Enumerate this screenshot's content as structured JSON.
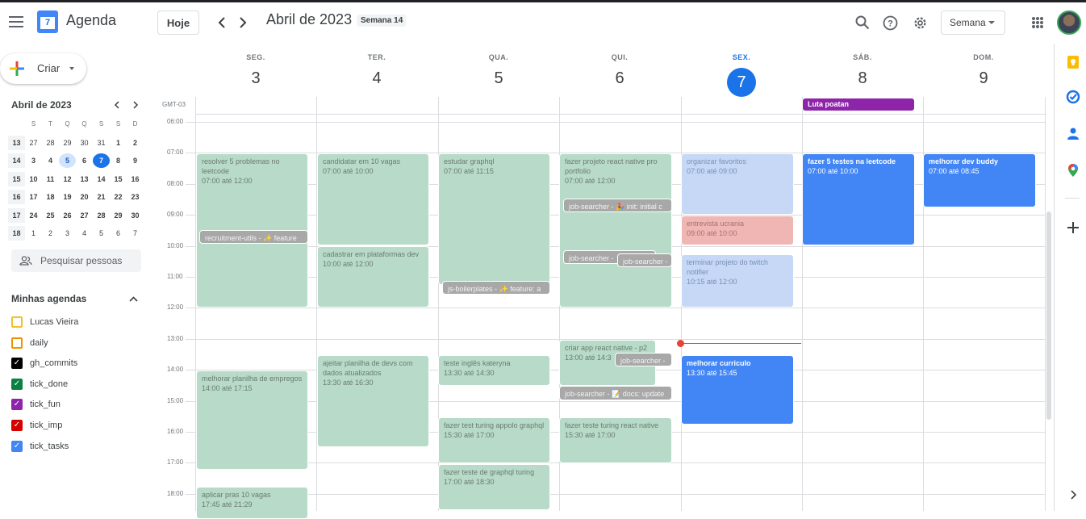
{
  "header": {
    "app_title": "Agenda",
    "logo_day": "7",
    "today_button": "Hoje",
    "month_title": "Abril de 2023",
    "week_badge": "Semana 14",
    "view_selector": "Semana"
  },
  "sidebar": {
    "create_button": "Criar",
    "mini_calendar": {
      "title": "Abril de 2023",
      "weekday_headers": [
        "S",
        "T",
        "Q",
        "Q",
        "S",
        "S",
        "D"
      ],
      "weeks": [
        {
          "week": "13",
          "days": [
            "27",
            "28",
            "29",
            "30",
            "31",
            "1",
            "2"
          ]
        },
        {
          "week": "14",
          "days": [
            "3",
            "4",
            "5",
            "6",
            "7",
            "8",
            "9"
          ]
        },
        {
          "week": "15",
          "days": [
            "10",
            "11",
            "12",
            "13",
            "14",
            "15",
            "16"
          ]
        },
        {
          "week": "16",
          "days": [
            "17",
            "18",
            "19",
            "20",
            "21",
            "22",
            "23"
          ]
        },
        {
          "week": "17",
          "days": [
            "24",
            "25",
            "26",
            "27",
            "28",
            "29",
            "30"
          ]
        },
        {
          "week": "18",
          "days": [
            "1",
            "2",
            "3",
            "4",
            "5",
            "6",
            "7"
          ]
        }
      ],
      "today": "7",
      "selected": "5"
    },
    "search_people_placeholder": "Pesquisar pessoas",
    "my_calendars_title": "Minhas agendas",
    "calendars": [
      {
        "label": "Lucas Vieira",
        "color": "#f6bf26",
        "checked": false
      },
      {
        "label": "daily",
        "color": "#f09300",
        "checked": false
      },
      {
        "label": "gh_commits",
        "color": "#000000",
        "checked": true
      },
      {
        "label": "tick_done",
        "color": "#0b8043",
        "checked": true
      },
      {
        "label": "tick_fun",
        "color": "#8e24aa",
        "checked": true
      },
      {
        "label": "tick_imp",
        "color": "#d50000",
        "checked": true
      },
      {
        "label": "tick_tasks",
        "color": "#4285f4",
        "checked": true
      }
    ]
  },
  "grid": {
    "timezone": "GMT-03",
    "days": [
      {
        "name": "SEG.",
        "num": "3"
      },
      {
        "name": "TER.",
        "num": "4"
      },
      {
        "name": "QUA.",
        "num": "5"
      },
      {
        "name": "QUI.",
        "num": "6"
      },
      {
        "name": "SEX.",
        "num": "7",
        "today": true
      },
      {
        "name": "SÁB.",
        "num": "8"
      },
      {
        "name": "DOM.",
        "num": "9"
      }
    ],
    "hours": [
      "06:00",
      "07:00",
      "08:00",
      "09:00",
      "10:00",
      "11:00",
      "12:00",
      "13:00",
      "14:00",
      "15:00",
      "16:00",
      "17:00",
      "18:00"
    ],
    "allday_event": "Luta poatan",
    "events": [
      {
        "title": "resolver 5 problemas no leetcode",
        "time": "07:00 até 12:00"
      },
      {
        "title": "recruitment-utils - ✨ feature"
      },
      {
        "title": "melhorar planilha de empregos",
        "time": "14:00 até 17:15"
      },
      {
        "title": "aplicar pras 10 vagas",
        "time": "17:45 até 21:29"
      },
      {
        "title": "candidatar em 10 vagas",
        "time": "07:00 até 10:00"
      },
      {
        "title": "cadastrar em plataformas dev",
        "time": "10:00 até 12:00"
      },
      {
        "title": "ajeitar planilha de devs com dados atualizados",
        "time": "13:30 até 16:30"
      },
      {
        "title": "estudar graphql",
        "time": "07:00 até 11:15"
      },
      {
        "title": "js-boilerplates - ✨ feature: a"
      },
      {
        "title": "teste inglês kateryna",
        "time": "13:30 até 14:30"
      },
      {
        "title": "fazer test turing appolo graphql",
        "time": "15:30 até 17:00"
      },
      {
        "title": "fazer teste de graphql turing",
        "time": "17:00 até 18:30"
      },
      {
        "title": "fazer projeto react native pro portfolio",
        "time": "07:00 até 12:00"
      },
      {
        "title": "job-searcher - 🎉 init: initial c"
      },
      {
        "title": "job-searcher -"
      },
      {
        "title": "job-searcher -"
      },
      {
        "title": "criar app react native - p2",
        "time": "13:00 até 14:3"
      },
      {
        "title": "job-searcher -"
      },
      {
        "title": "job-searcher - 📝 docs: update"
      },
      {
        "title": "fazer teste turing react native",
        "time": "15:30 até 17:00"
      },
      {
        "title": "organizar favoritos",
        "time": "07:00 até 09:00"
      },
      {
        "title": "entrevista ucrania",
        "time": "09:00 até 10:00"
      },
      {
        "title": "terminar projeto do twitch notifier",
        "time": "10:15 até 12:00"
      },
      {
        "title": "melhorar curriculo",
        "time": "13:30 até 15:45"
      },
      {
        "title": "fazer 5 testes na leetcode",
        "time": "07:00 até 10:00"
      },
      {
        "title": "melhorar dev buddy",
        "time": "07:00 até 08:45"
      }
    ]
  },
  "icons": [
    "menu-icon",
    "chevron-left-icon",
    "chevron-right-icon",
    "search-icon",
    "help-icon",
    "settings-icon",
    "apps-icon",
    "keep-icon",
    "tasks-icon",
    "contacts-icon",
    "maps-icon",
    "add-icon"
  ]
}
